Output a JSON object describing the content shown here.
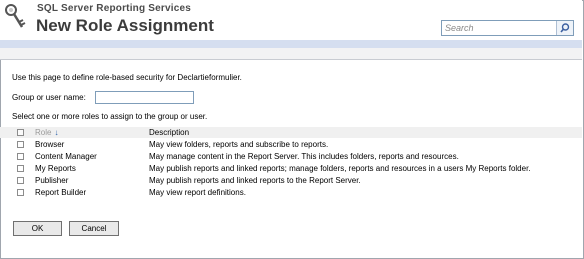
{
  "header": {
    "product_name": "SQL Server Reporting Services",
    "page_title": "New Role Assignment",
    "search": {
      "placeholder": "Search",
      "value": ""
    }
  },
  "main": {
    "intro_text": "Use this page to define role-based security for Declartieformulier.",
    "group_user_label": "Group or user name:",
    "group_user_value": "",
    "select_roles_text": "Select one or more roles to assign to the group or user.",
    "table": {
      "headers": {
        "role": "Role",
        "description": "Description",
        "sort_indicator": "down-arrow-icon"
      },
      "rows": [
        {
          "role": "Browser",
          "description": "May view folders, reports and subscribe to reports."
        },
        {
          "role": "Content Manager",
          "description": "May manage content in the Report Server.  This includes folders, reports and resources."
        },
        {
          "role": "My Reports",
          "description": "May publish reports and linked reports; manage folders, reports and resources in a users My Reports folder."
        },
        {
          "role": "Publisher",
          "description": "May publish reports and linked reports to the Report Server."
        },
        {
          "role": "Report Builder",
          "description": "May view report definitions."
        }
      ]
    },
    "buttons": {
      "ok": "OK",
      "cancel": "Cancel"
    }
  },
  "colors": {
    "header_band": "#d5def0",
    "toolbar_band": "#f2f2f4",
    "sort_arrow": "#2a5ea8"
  }
}
